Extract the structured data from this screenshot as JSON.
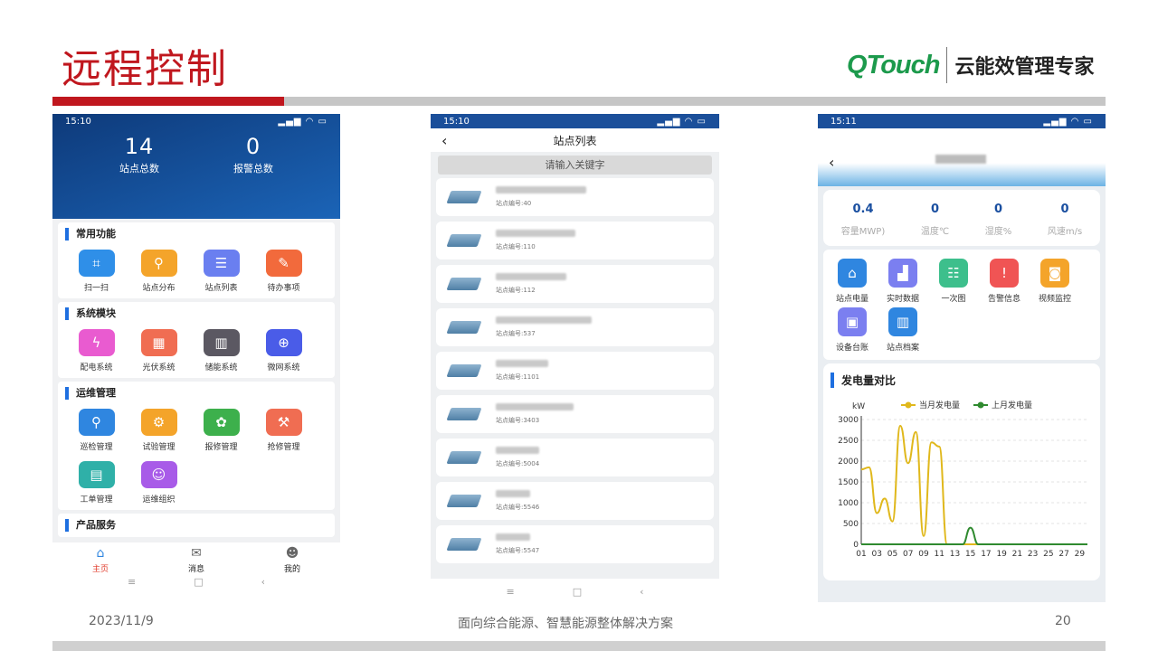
{
  "slide": {
    "title": "远程控制",
    "brand": "QTouch",
    "tagline": "云能效管理专家",
    "date": "2023/11/9",
    "footer": "面向综合能源、智慧能源整体解决方案",
    "page": "20"
  },
  "p1": {
    "time": "15:10",
    "stats": [
      {
        "n": "14",
        "l": "站点总数"
      },
      {
        "n": "0",
        "l": "报警总数"
      }
    ],
    "sections": [
      {
        "title": "常用功能",
        "items": [
          {
            "label": "扫一扫",
            "icon": "scan-icon",
            "color": "#2f8fe8"
          },
          {
            "label": "站点分布",
            "icon": "map-icon",
            "color": "#f4a42a"
          },
          {
            "label": "站点列表",
            "icon": "list-icon",
            "color": "#6a7ff0"
          },
          {
            "label": "待办事项",
            "icon": "todo-icon",
            "color": "#f26a3c"
          }
        ]
      },
      {
        "title": "系统模块",
        "items": [
          {
            "label": "配电系统",
            "icon": "power-icon",
            "color": "#e95bd0"
          },
          {
            "label": "光伏系统",
            "icon": "solar-icon",
            "color": "#f06d52"
          },
          {
            "label": "储能系统",
            "icon": "storage-icon",
            "color": "#5b5862"
          },
          {
            "label": "微网系统",
            "icon": "globe-icon",
            "color": "#4a5ce8"
          }
        ]
      },
      {
        "title": "运维管理",
        "items": [
          {
            "label": "巡检管理",
            "icon": "patrol-icon",
            "color": "#2f86e0"
          },
          {
            "label": "试验管理",
            "icon": "test-icon",
            "color": "#f4a42a"
          },
          {
            "label": "报修管理",
            "icon": "repair-icon",
            "color": "#3db04c"
          },
          {
            "label": "抢修管理",
            "icon": "toolbox-icon",
            "color": "#f06d52"
          },
          {
            "label": "工单管理",
            "icon": "workorder-icon",
            "color": "#2fb0a8"
          },
          {
            "label": "运维组织",
            "icon": "team-icon",
            "color": "#a85be8"
          }
        ]
      },
      {
        "title": "产品服务",
        "items": []
      }
    ],
    "tabs": [
      {
        "label": "主页",
        "icon": "home-icon"
      },
      {
        "label": "消息",
        "icon": "mail-icon"
      },
      {
        "label": "我的",
        "icon": "user-icon"
      }
    ]
  },
  "p2": {
    "time": "15:10",
    "title": "站点列表",
    "search_placeholder": "请输入关键字",
    "sites": [
      {
        "code": "站点编号:40",
        "w": 100
      },
      {
        "code": "站点编号:110",
        "w": 88
      },
      {
        "code": "站点编号:112",
        "w": 78
      },
      {
        "code": "站点编号:537",
        "w": 106
      },
      {
        "code": "站点编号:1101",
        "w": 58
      },
      {
        "code": "站点编号:3403",
        "w": 86
      },
      {
        "code": "站点编号:5004",
        "w": 48
      },
      {
        "code": "站点编号:5546",
        "w": 38
      },
      {
        "code": "站点编号:5547",
        "w": 38
      }
    ]
  },
  "p3": {
    "time": "15:11",
    "metrics": [
      {
        "v": "0.4",
        "k": "容量MWP)"
      },
      {
        "v": "0",
        "k": "温度℃"
      },
      {
        "v": "0",
        "k": "湿度%"
      },
      {
        "v": "0",
        "k": "风速m/s"
      }
    ],
    "functions": [
      {
        "label": "站点电量",
        "icon": "station-icon",
        "color": "#2f86e0"
      },
      {
        "label": "实时数据",
        "icon": "chart-icon",
        "color": "#7b7ff0"
      },
      {
        "label": "一次图",
        "icon": "diagram-icon",
        "color": "#3dbf8c"
      },
      {
        "label": "告警信息",
        "icon": "warning-icon",
        "color": "#f05454"
      },
      {
        "label": "视频监控",
        "icon": "camera-icon",
        "color": "#f4a42a"
      },
      {
        "label": "设备台账",
        "icon": "ledger-icon",
        "color": "#7b7ff0"
      },
      {
        "label": "站点档案",
        "icon": "archive-icon",
        "color": "#2f86e0"
      }
    ],
    "chart_title": "发电量对比"
  },
  "chart_data": {
    "type": "line",
    "title": "发电量对比",
    "ylabel": "kW",
    "ylim": [
      0,
      3000
    ],
    "yticks": [
      0,
      500,
      1000,
      1500,
      2000,
      2500,
      3000
    ],
    "xticks": [
      "01",
      "03",
      "05",
      "07",
      "09",
      "11",
      "13",
      "15",
      "17",
      "19",
      "21",
      "23",
      "25",
      "27",
      "29"
    ],
    "x": [
      1,
      2,
      3,
      4,
      5,
      6,
      7,
      8,
      9,
      10,
      11,
      12,
      13,
      14,
      15,
      16,
      17,
      18,
      19,
      20,
      21,
      22,
      23,
      24,
      25,
      26,
      27,
      28,
      29,
      30
    ],
    "series": [
      {
        "name": "当月发电量",
        "color": "#e0b81c",
        "values": [
          1800,
          1850,
          750,
          1100,
          550,
          2850,
          1950,
          2700,
          200,
          2450,
          2350,
          0,
          0,
          0,
          0,
          0,
          0,
          0,
          0,
          0,
          0,
          0,
          0,
          0,
          0,
          0,
          0,
          0,
          0,
          0
        ]
      },
      {
        "name": "上月发电量",
        "color": "#2f8a2f",
        "values": [
          0,
          0,
          0,
          0,
          0,
          0,
          0,
          0,
          0,
          0,
          0,
          0,
          0,
          0,
          400,
          0,
          0,
          0,
          0,
          0,
          0,
          0,
          0,
          0,
          0,
          0,
          0,
          0,
          0,
          0
        ]
      }
    ]
  }
}
